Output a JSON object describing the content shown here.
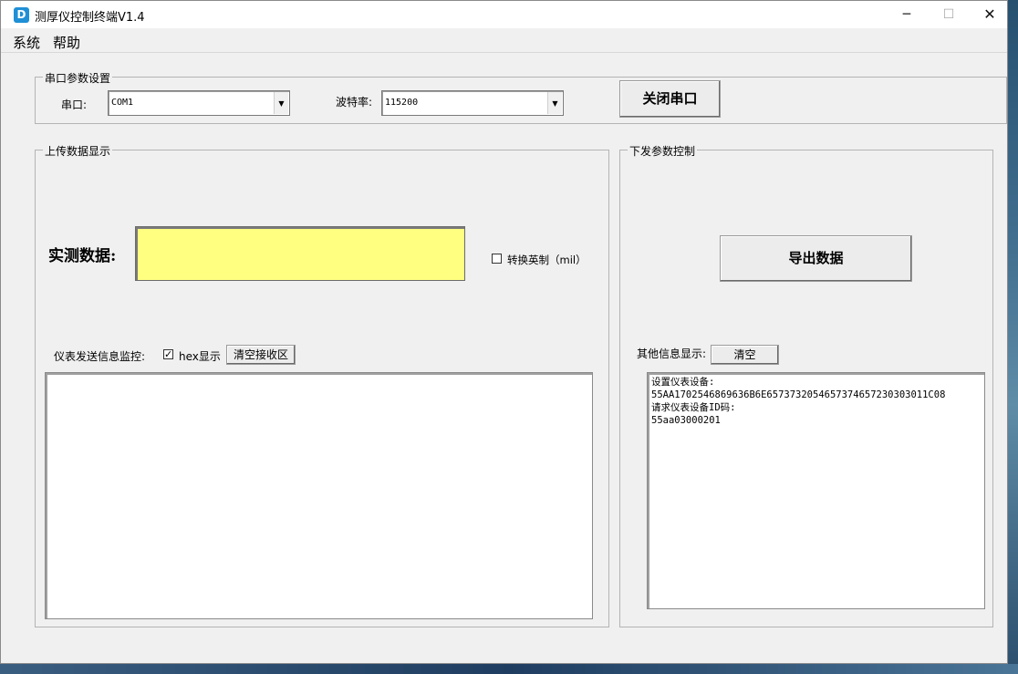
{
  "window": {
    "title": "测厚仪控制终端V1.4",
    "icon_name": "app-logo-icon",
    "controls": {
      "minimize": "─",
      "maximize": "☐",
      "close": "✕"
    }
  },
  "menu": {
    "items": [
      "系统",
      "帮助"
    ]
  },
  "serial": {
    "group_title": "串口参数设置",
    "port_label": "串口:",
    "port_value": "COM1",
    "baud_label": "波特率:",
    "baud_value": "115200",
    "close_button": "关闭串口"
  },
  "upload": {
    "group_title": "上传数据显示",
    "measure_label": "实测数据:",
    "measure_value": "",
    "convert_label": "转换英制（mil）",
    "convert_checked": false,
    "monitor_label": "仪表发送信息监控:",
    "hex_label": "hex显示",
    "hex_checked": true,
    "clear_button": "清空接收区",
    "monitor_text": ""
  },
  "download": {
    "group_title": "下发参数控制",
    "export_button": "导出数据",
    "other_info_label": "其他信息显示:",
    "clear_button": "清空",
    "info_lines": [
      "设置仪表设备:",
      "55AA1702546869636B6E6573732054657374657230303011C08",
      "请求仪表设备ID码:",
      "55aa03000201"
    ]
  }
}
